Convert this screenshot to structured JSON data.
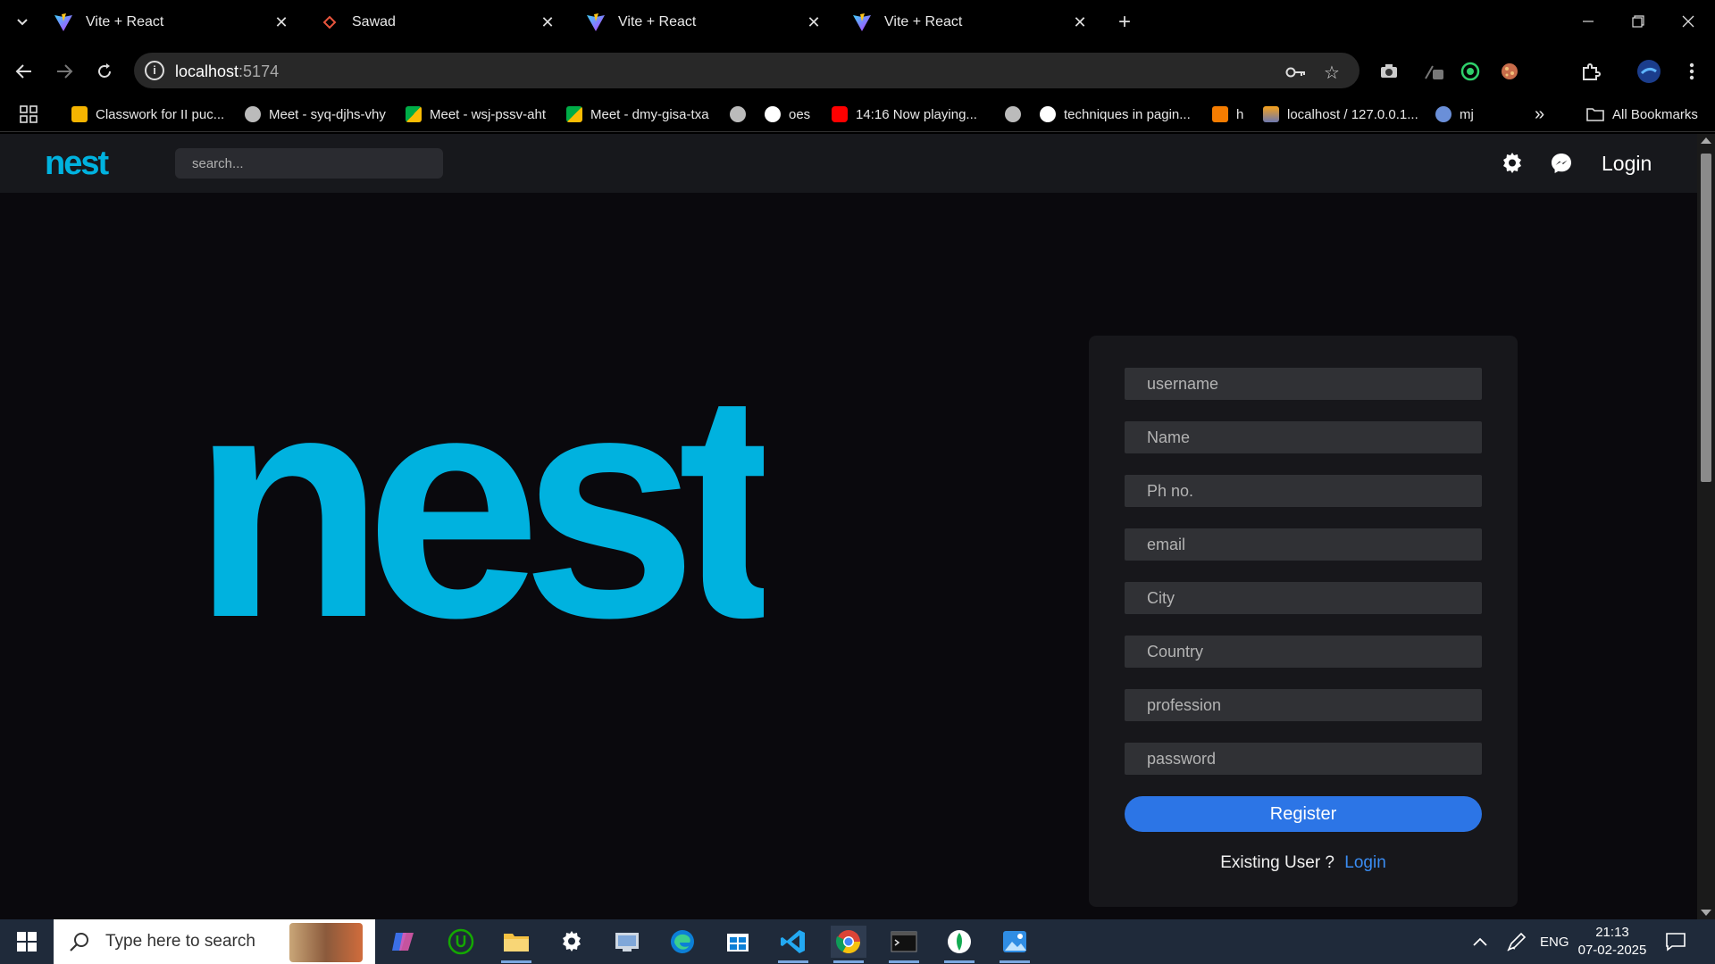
{
  "browser": {
    "tabs": [
      {
        "title": "Vite + React",
        "icon": "vite-icon"
      },
      {
        "title": "Sawad",
        "icon": "diamond-icon"
      },
      {
        "title": "Vite + React",
        "icon": "vite-icon"
      },
      {
        "title": "Vite + React",
        "icon": "vite-icon"
      }
    ],
    "address": {
      "host": "localhost",
      "port": ":5174"
    },
    "bookmarks": [
      {
        "label": "Classwork for II puc...",
        "icon": "classroom-icon"
      },
      {
        "label": "Meet - syq-djhs-vhy",
        "icon": "globe-icon"
      },
      {
        "label": "Meet - wsj-pssv-aht",
        "icon": "meet-icon"
      },
      {
        "label": "Meet - dmy-gisa-txa",
        "icon": "meet-icon"
      },
      {
        "label": "",
        "icon": "globe-icon"
      },
      {
        "label": "oes",
        "icon": "google-icon"
      },
      {
        "label": "14:16 Now playing...",
        "icon": "youtube-icon"
      },
      {
        "label": "",
        "icon": "globe-icon"
      },
      {
        "label": "techniques in pagin...",
        "icon": "google-icon"
      },
      {
        "label": "h",
        "icon": "b-icon"
      },
      {
        "label": "localhost / 127.0.0.1...",
        "icon": "phpmyadmin-icon"
      },
      {
        "label": "mj",
        "icon": "profile-icon"
      }
    ],
    "all_bookmarks_label": "All Bookmarks"
  },
  "app": {
    "logo": "nest",
    "search_placeholder": "search...",
    "login_label": "Login",
    "hero_logo": "nest"
  },
  "form": {
    "fields": [
      {
        "placeholder": "username"
      },
      {
        "placeholder": "Name"
      },
      {
        "placeholder": "Ph no."
      },
      {
        "placeholder": "email"
      },
      {
        "placeholder": "City"
      },
      {
        "placeholder": "Country"
      },
      {
        "placeholder": "profession"
      },
      {
        "placeholder": "password"
      }
    ],
    "register_label": "Register",
    "existing_text": "Existing User ?",
    "login_link": "Login"
  },
  "taskbar": {
    "search_placeholder": "Type here to search",
    "language": "ENG",
    "time": "21:13",
    "date": "07-02-2025"
  },
  "colors": {
    "brand": "#00b2df",
    "accent": "#2c75e6",
    "link": "#3a8cf2"
  }
}
